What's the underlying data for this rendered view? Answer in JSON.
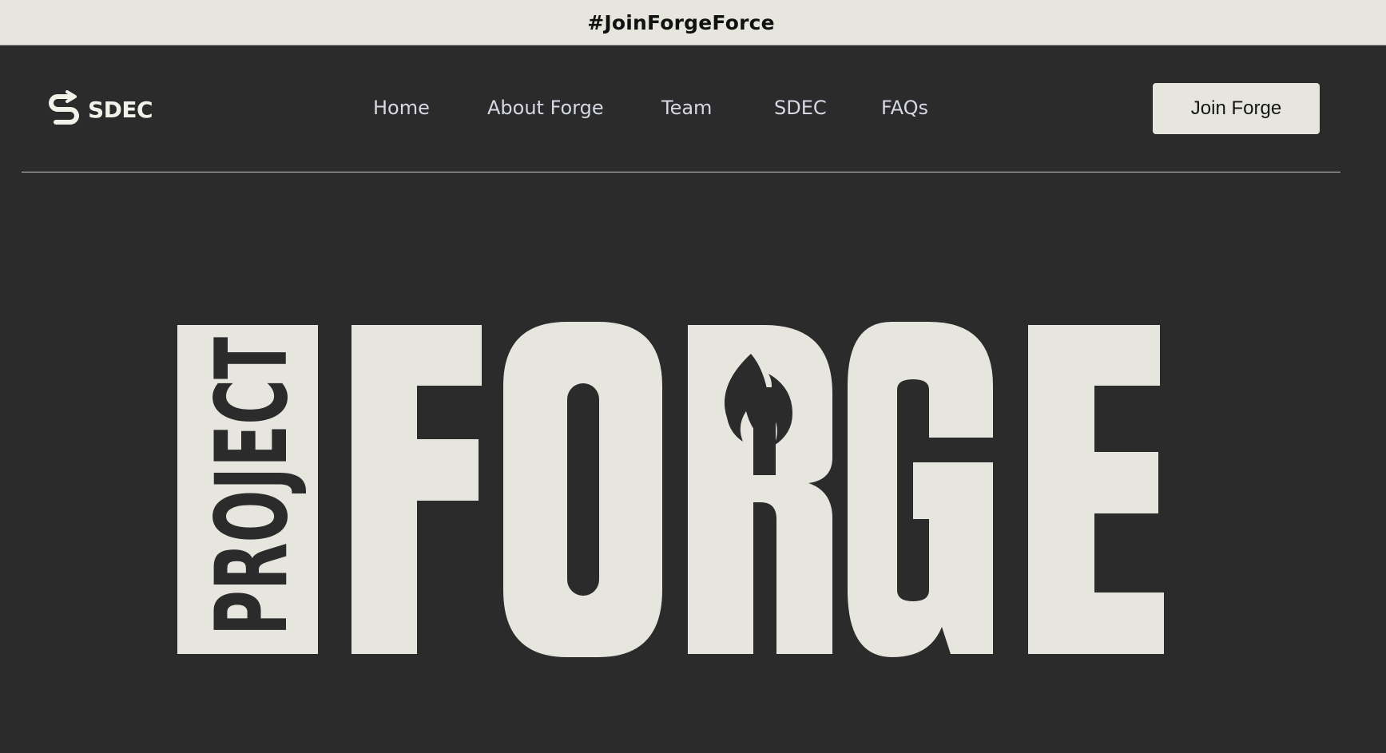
{
  "banner": {
    "text": "#JoinForgeForce"
  },
  "header": {
    "logo_text": "SDEC",
    "logo_icon": "sdec-s-arrow-icon",
    "nav": [
      {
        "label": "Home"
      },
      {
        "label": "About Forge"
      },
      {
        "label": "Team"
      },
      {
        "label": "SDEC"
      },
      {
        "label": "FAQs"
      }
    ],
    "cta_label": "Join Forge"
  },
  "hero": {
    "wordmark": "PROJECT FORGE",
    "wordmark_icon": "flame-icon"
  },
  "colors": {
    "background": "#2b2b2b",
    "banner_bg": "#e6e5de",
    "wordmark": "#e6e5de",
    "nav_text": "#d6d8e4"
  }
}
